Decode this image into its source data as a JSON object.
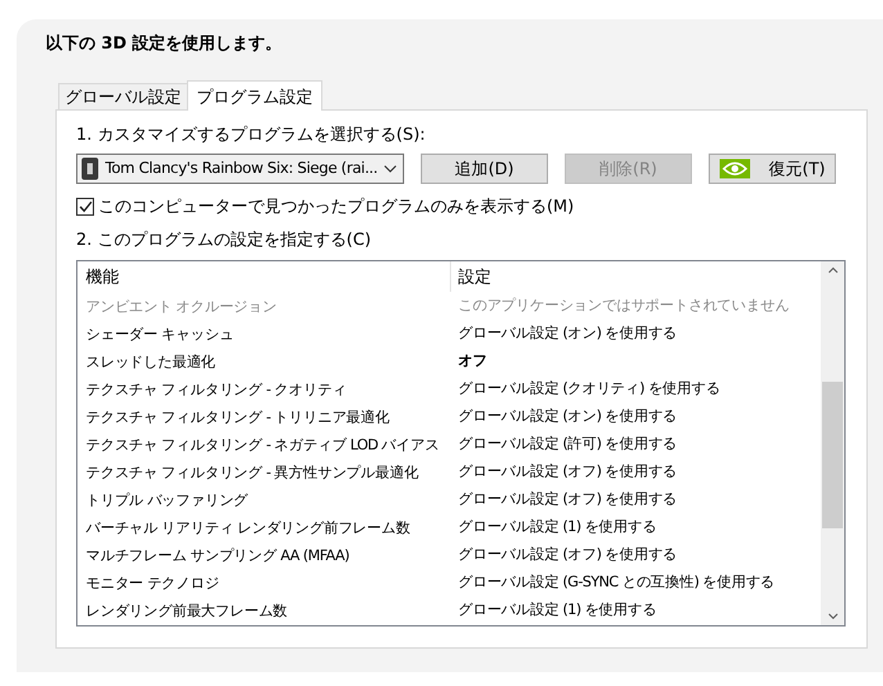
{
  "heading": "以下の 3D 設定を使用します。",
  "tabs": [
    {
      "label": "グローバル設定",
      "selected": false
    },
    {
      "label": "プログラム設定",
      "selected": true
    }
  ],
  "step1_label": "1. カスタマイズするプログラムを選択する(S):",
  "program_select": {
    "value": "Tom Clancy's Rainbow Six: Siege (rai..."
  },
  "buttons": [
    {
      "label": "追加(D)",
      "disabled": false,
      "kind": "plain"
    },
    {
      "label": "削除(R)",
      "disabled": true,
      "kind": "plain"
    },
    {
      "label": "復元(T)",
      "disabled": false,
      "kind": "logo"
    }
  ],
  "only_found_checkbox": {
    "label": "このコンピューターで見つかったプログラムのみを表示する(M)",
    "checked": true
  },
  "step2_label": "2. このプログラムの設定を指定する(C)",
  "table": {
    "columns": [
      "機能",
      "設定"
    ],
    "rows": [
      {
        "feature": "アンビエント オクルージョン",
        "setting": "このアプリケーションではサポートされていません",
        "disabled": true,
        "customized": false
      },
      {
        "feature": "シェーダー キャッシュ",
        "setting": "グローバル設定 (オン) を使用する",
        "disabled": false,
        "customized": false
      },
      {
        "feature": "スレッドした最適化",
        "setting": "オフ",
        "disabled": false,
        "customized": true
      },
      {
        "feature": "テクスチャ フィルタリング - クオリティ",
        "setting": "グローバル設定 (クオリティ) を使用する",
        "disabled": false,
        "customized": false
      },
      {
        "feature": "テクスチャ フィルタリング - トリリニア最適化",
        "setting": "グローバル設定 (オン) を使用する",
        "disabled": false,
        "customized": false
      },
      {
        "feature": "テクスチャ フィルタリング - ネガティブ LOD バイアス",
        "setting": "グローバル設定 (許可) を使用する",
        "disabled": false,
        "customized": false
      },
      {
        "feature": "テクスチャ フィルタリング - 異方性サンプル最適化",
        "setting": "グローバル設定 (オフ) を使用する",
        "disabled": false,
        "customized": false
      },
      {
        "feature": "トリプル バッファリング",
        "setting": "グローバル設定 (オフ) を使用する",
        "disabled": false,
        "customized": false
      },
      {
        "feature": "バーチャル リアリティ レンダリング前フレーム数",
        "setting": "グローバル設定 (1) を使用する",
        "disabled": false,
        "customized": false
      },
      {
        "feature": "マルチフレーム サンプリング AA (MFAA)",
        "setting": "グローバル設定 (オフ) を使用する",
        "disabled": false,
        "customized": false
      },
      {
        "feature": "モニター テクノロジ",
        "setting": "グローバル設定 (G-SYNC との互換性) を使用する",
        "disabled": false,
        "customized": false
      },
      {
        "feature": "レンダリング前最大フレーム数",
        "setting": "グローバル設定 (1) を使用する",
        "disabled": false,
        "customized": false
      }
    ]
  }
}
